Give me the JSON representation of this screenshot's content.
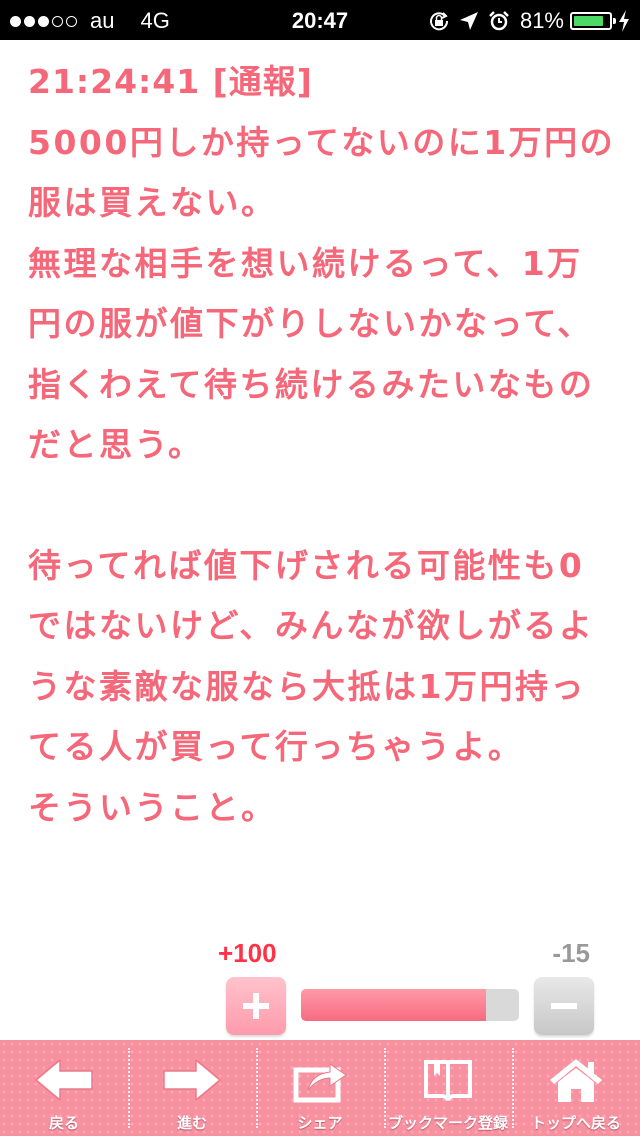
{
  "status_bar": {
    "carrier": "au",
    "network": "4G",
    "time": "20:47",
    "battery_percent": "81%",
    "battery_level": 0.81,
    "signal_dots_filled": 3,
    "signal_dots_total": 5
  },
  "post": {
    "header": "21:24:41 [通報]",
    "paragraph1": "5000円しか持ってないのに1万円の服は買えない。\n無理な相手を想い続けるって、1万円の服が値下がりしないかなって、指くわえて待ち続けるみたいなものだと思う。",
    "paragraph2": "待ってれば値下げされる可能性も0ではないけど、みんなが欲しがるような素敵な服なら大抵は1万円持ってる人が買って行っちゃうよ。\nそういうこと。"
  },
  "votes": {
    "plus_count": "+100",
    "minus_count": "-15",
    "plus_ratio": 0.85
  },
  "nav": {
    "back": "戻る",
    "forward": "進む",
    "share": "シェア",
    "bookmark": "ブックマーク登録",
    "top": "トップへ戻る"
  },
  "colors": {
    "text_accent": "#f5687a",
    "plus_red": "#ff3347",
    "nav_pink": "#f7909f"
  }
}
